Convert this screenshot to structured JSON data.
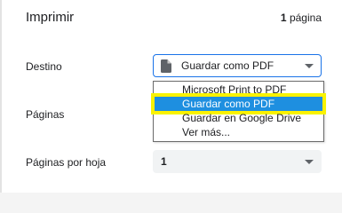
{
  "header": {
    "title": "Imprimir",
    "page_count_number": "1",
    "page_count_unit": "página"
  },
  "rows": {
    "destination_label": "Destino",
    "pages_label": "Páginas",
    "pages_per_sheet_label": "Páginas por hoja"
  },
  "destination_select": {
    "value": "Guardar como PDF",
    "icon": "document-icon"
  },
  "destination_options": [
    "Microsoft Print to PDF",
    "Guardar como PDF",
    "Guardar en Google Drive",
    "Ver más..."
  ],
  "selected_option": "Guardar como PDF",
  "pages_per_sheet_select": {
    "value": "1"
  },
  "colors": {
    "accent_blue": "#1a73e8",
    "selection_blue": "#1e8fe0",
    "highlight_yellow": "#f2ef00"
  }
}
